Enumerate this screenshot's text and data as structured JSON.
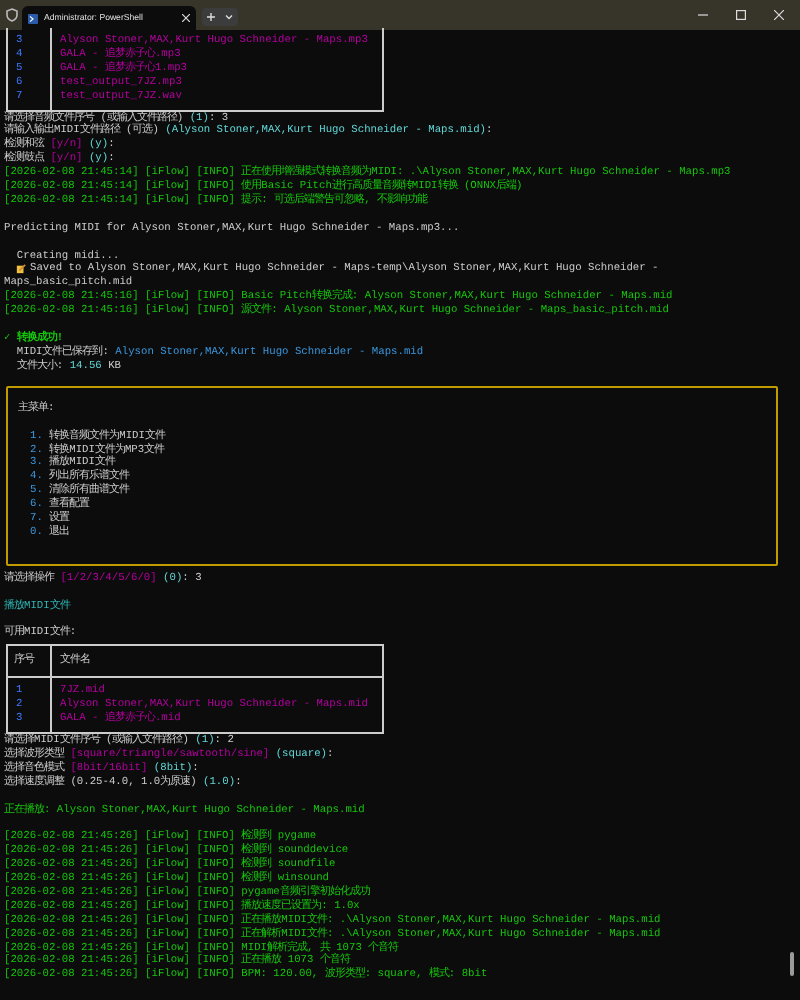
{
  "window": {
    "tab_title": "Administrator: PowerShell"
  },
  "blocks": [
    {
      "kind": "table",
      "rows": [
        {
          "index": "3",
          "file": "Alyson Stoner,MAX,Kurt Hugo Schneider - Maps.mp3"
        },
        {
          "index": "4",
          "file": "GALA - 追梦赤子心.mp3"
        },
        {
          "index": "5",
          "file": "GALA - 追梦赤子心1.mp3"
        },
        {
          "index": "6",
          "file": "test_output_7JZ.mp3"
        },
        {
          "index": "7",
          "file": "test_output_7JZ.wav"
        }
      ]
    },
    {
      "kind": "line",
      "spaced": false,
      "segments": [
        {
          "kind": "plain",
          "text": "请选择音频文件序号 (或输入文件路径) "
        },
        {
          "kind": "default",
          "text": "(1)"
        },
        {
          "kind": "plain",
          "text": ": 3"
        }
      ]
    },
    {
      "kind": "line",
      "spaced": false,
      "segments": [
        {
          "kind": "plain",
          "text": "请输入输出MIDI文件路径 (可选) "
        },
        {
          "kind": "default",
          "text": "(Alyson Stoner,MAX,Kurt Hugo Schneider - Maps.mid)"
        },
        {
          "kind": "plain",
          "text": ":"
        }
      ]
    },
    {
      "kind": "line",
      "spaced": false,
      "segments": [
        {
          "kind": "plain",
          "text": "检测和弦 "
        },
        {
          "kind": "choices",
          "text": "[y/n] "
        },
        {
          "kind": "default",
          "text": "(y)"
        },
        {
          "kind": "plain",
          "text": ":"
        }
      ]
    },
    {
      "kind": "line",
      "spaced": false,
      "segments": [
        {
          "kind": "plain",
          "text": "检测鼓点 "
        },
        {
          "kind": "choices",
          "text": "[y/n] "
        },
        {
          "kind": "default",
          "text": "(y)"
        },
        {
          "kind": "plain",
          "text": ":"
        }
      ]
    },
    {
      "kind": "line",
      "spaced": false,
      "segments": [
        {
          "kind": "log",
          "text": "[2026-02-08 21:45:14] [iFlow] [INFO] 正在使用增强模式转换音频为MIDI: .\\Alyson Stoner,MAX,Kurt Hugo Schneider - Maps.mp3"
        }
      ]
    },
    {
      "kind": "line",
      "spaced": false,
      "segments": [
        {
          "kind": "log",
          "text": "[2026-02-08 21:45:14] [iFlow] [INFO] 使用Basic Pitch进行高质量音频转MIDI转换 (ONNX后端)"
        }
      ]
    },
    {
      "kind": "line",
      "spaced": false,
      "segments": [
        {
          "kind": "log",
          "text": "[2026-02-08 21:45:14] [iFlow] [INFO] 提示: 可选后端警告可忽略, 不影响功能"
        }
      ]
    },
    {
      "kind": "line",
      "spaced": true,
      "segments": [
        {
          "kind": "plain",
          "text": "Predicting MIDI for Alyson Stoner,MAX,Kurt Hugo Schneider - Maps.mp3..."
        }
      ]
    },
    {
      "kind": "line",
      "spaced": true,
      "segments": [
        {
          "kind": "plain",
          "text": "  Creating midi..."
        }
      ]
    },
    {
      "kind": "saved",
      "spaced": false,
      "segments": [
        {
          "kind": "plain",
          "text": "Saved to Alyson Stoner,MAX,Kurt Hugo Schneider - Maps-temp\\Alyson Stoner,MAX,Kurt Hugo Schneider -"
        }
      ]
    },
    {
      "kind": "line",
      "spaced": false,
      "segments": [
        {
          "kind": "plain",
          "text": "Maps_basic_pitch.mid"
        }
      ]
    },
    {
      "kind": "line",
      "spaced": false,
      "segments": [
        {
          "kind": "log",
          "text": "[2026-02-08 21:45:16] [iFlow] [INFO] Basic Pitch转换完成: Alyson Stoner,MAX,Kurt Hugo Schneider - Maps.mid"
        }
      ]
    },
    {
      "kind": "line",
      "spaced": false,
      "segments": [
        {
          "kind": "log",
          "text": "[2026-02-08 21:45:16] [iFlow] [INFO] 源文件: Alyson Stoner,MAX,Kurt Hugo Schneider - Maps_basic_pitch.mid"
        }
      ]
    },
    {
      "kind": "line",
      "spaced": true,
      "segments": [
        {
          "kind": "success",
          "text": "✓ 转换成功!"
        }
      ]
    },
    {
      "kind": "line",
      "spaced": false,
      "segments": [
        {
          "kind": "plain",
          "text": "  MIDI文件已保存到: "
        },
        {
          "kind": "path",
          "text": "Alyson Stoner,MAX,Kurt Hugo Schneider - Maps.mid"
        }
      ]
    },
    {
      "kind": "line",
      "spaced": false,
      "segments": [
        {
          "kind": "plain",
          "text": "  文件大小: "
        },
        {
          "kind": "number",
          "text": "14.56"
        },
        {
          "kind": "plain",
          "text": " KB"
        }
      ]
    },
    {
      "kind": "menu",
      "title": "主菜单:",
      "items": [
        {
          "number": "1.",
          "label": "转换音频文件为MIDI文件"
        },
        {
          "number": "2.",
          "label": "转换MIDI文件为MP3文件"
        },
        {
          "number": "3.",
          "label": "播放MIDI文件"
        },
        {
          "number": "4.",
          "label": "列出所有乐谱文件"
        },
        {
          "number": "5.",
          "label": "清除所有曲谱文件"
        },
        {
          "number": "6.",
          "label": "查看配置"
        },
        {
          "number": "7.",
          "label": "设置"
        },
        {
          "number": "0.",
          "label": "退出"
        }
      ]
    },
    {
      "kind": "line",
      "spaced": false,
      "segments": [
        {
          "kind": "plain",
          "text": "请选择操作 "
        },
        {
          "kind": "choices",
          "text": "[1/2/3/4/5/6/0] "
        },
        {
          "kind": "default",
          "text": "(0)"
        },
        {
          "kind": "plain",
          "text": ": 3"
        }
      ]
    },
    {
      "kind": "line",
      "spaced": true,
      "segments": [
        {
          "kind": "heading",
          "text": "播放MIDI文件"
        }
      ]
    },
    {
      "kind": "line",
      "spaced": true,
      "segments": [
        {
          "kind": "plain",
          "text": "可用MIDI文件:"
        }
      ]
    },
    {
      "kind": "table",
      "header": {
        "index": "序号",
        "file": "文件名"
      },
      "rows": [
        {
          "index": "1",
          "file": "7JZ.mid"
        },
        {
          "index": "2",
          "file": "Alyson Stoner,MAX,Kurt Hugo Schneider - Maps.mid"
        },
        {
          "index": "3",
          "file": "GALA - 追梦赤子心.mid"
        }
      ]
    },
    {
      "kind": "line",
      "spaced": false,
      "segments": [
        {
          "kind": "plain",
          "text": "请选择MIDI文件序号 (或输入文件路径) "
        },
        {
          "kind": "default",
          "text": "(1)"
        },
        {
          "kind": "plain",
          "text": ": 2"
        }
      ]
    },
    {
      "kind": "line",
      "spaced": false,
      "segments": [
        {
          "kind": "plain",
          "text": "选择波形类型 "
        },
        {
          "kind": "choices",
          "text": "[square/triangle/sawtooth/sine] "
        },
        {
          "kind": "default",
          "text": "(square)"
        },
        {
          "kind": "plain",
          "text": ":"
        }
      ]
    },
    {
      "kind": "line",
      "spaced": false,
      "segments": [
        {
          "kind": "plain",
          "text": "选择音色模式 "
        },
        {
          "kind": "choices",
          "text": "[8bit/16bit] "
        },
        {
          "kind": "default",
          "text": "(8bit)"
        },
        {
          "kind": "plain",
          "text": ":"
        }
      ]
    },
    {
      "kind": "line",
      "spaced": false,
      "segments": [
        {
          "kind": "plain",
          "text": "选择速度调整 (0.25-4.0, 1.0为原速) "
        },
        {
          "kind": "default",
          "text": "(1.0)"
        },
        {
          "kind": "plain",
          "text": ":"
        }
      ]
    },
    {
      "kind": "line",
      "spaced": true,
      "segments": [
        {
          "kind": "log",
          "text": "正在播放: Alyson Stoner,MAX,Kurt Hugo Schneider - Maps.mid"
        }
      ]
    },
    {
      "kind": "line",
      "spaced": true,
      "segments": [
        {
          "kind": "log",
          "text": "[2026-02-08 21:45:26] [iFlow] [INFO] 检测到 pygame"
        }
      ]
    },
    {
      "kind": "line",
      "spaced": false,
      "segments": [
        {
          "kind": "log",
          "text": "[2026-02-08 21:45:26] [iFlow] [INFO] 检测到 sounddevice"
        }
      ]
    },
    {
      "kind": "line",
      "spaced": false,
      "segments": [
        {
          "kind": "log",
          "text": "[2026-02-08 21:45:26] [iFlow] [INFO] 检测到 soundfile"
        }
      ]
    },
    {
      "kind": "line",
      "spaced": false,
      "segments": [
        {
          "kind": "log",
          "text": "[2026-02-08 21:45:26] [iFlow] [INFO] 检测到 winsound"
        }
      ]
    },
    {
      "kind": "line",
      "spaced": false,
      "segments": [
        {
          "kind": "log",
          "text": "[2026-02-08 21:45:26] [iFlow] [INFO] pygame音频引擎初始化成功"
        }
      ]
    },
    {
      "kind": "line",
      "spaced": false,
      "segments": [
        {
          "kind": "log",
          "text": "[2026-02-08 21:45:26] [iFlow] [INFO] 播放速度已设置为: 1.0x"
        }
      ]
    },
    {
      "kind": "line",
      "spaced": false,
      "segments": [
        {
          "kind": "log",
          "text": "[2026-02-08 21:45:26] [iFlow] [INFO] 正在播放MIDI文件: .\\Alyson Stoner,MAX,Kurt Hugo Schneider - Maps.mid"
        }
      ]
    },
    {
      "kind": "line",
      "spaced": false,
      "segments": [
        {
          "kind": "log",
          "text": "[2026-02-08 21:45:26] [iFlow] [INFO] 正在解析MIDI文件: .\\Alyson Stoner,MAX,Kurt Hugo Schneider - Maps.mid"
        }
      ]
    },
    {
      "kind": "line",
      "spaced": false,
      "segments": [
        {
          "kind": "log",
          "text": "[2026-02-08 21:45:26] [iFlow] [INFO] MIDI解析完成, 共 1073 个音符"
        }
      ]
    },
    {
      "kind": "line",
      "spaced": false,
      "segments": [
        {
          "kind": "log",
          "text": "[2026-02-08 21:45:26] [iFlow] [INFO] 正在播放 1073 个音符"
        }
      ]
    },
    {
      "kind": "line",
      "spaced": false,
      "segments": [
        {
          "kind": "log",
          "text": "[2026-02-08 21:45:26] [iFlow] [INFO] BPM: 120.00, 波形类型: square, 模式: 8bit"
        }
      ]
    }
  ]
}
